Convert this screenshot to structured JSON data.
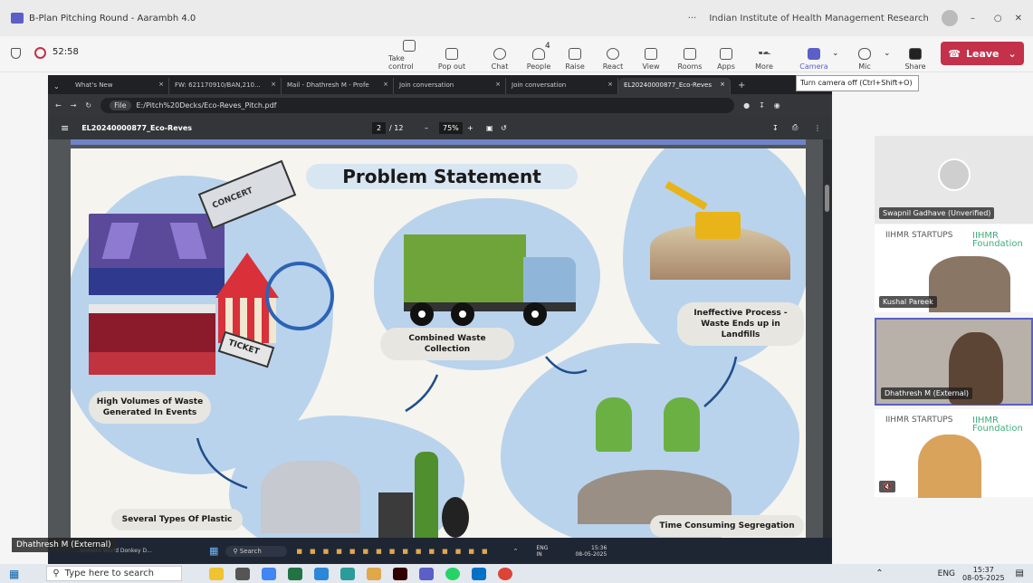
{
  "window": {
    "title": "B-Plan Pitching Round - Aarambh 4.0",
    "org": "Indian Institute of Health Management Research",
    "more": "···"
  },
  "meeting": {
    "timer": "52:58",
    "toolbar": [
      {
        "label": "Take control",
        "icon": "take-control-icon"
      },
      {
        "label": "Pop out",
        "icon": "pop-out-icon"
      },
      {
        "label": "Chat",
        "icon": "chat-icon"
      },
      {
        "label": "People",
        "icon": "people-icon",
        "badge": "4"
      },
      {
        "label": "Raise",
        "icon": "raise-hand-icon"
      },
      {
        "label": "React",
        "icon": "react-icon"
      },
      {
        "label": "View",
        "icon": "view-icon"
      },
      {
        "label": "Rooms",
        "icon": "rooms-icon"
      },
      {
        "label": "Apps",
        "icon": "apps-icon"
      },
      {
        "label": "More",
        "icon": "more-icon"
      },
      {
        "label": "Camera",
        "icon": "camera-icon"
      },
      {
        "label": "Mic",
        "icon": "mic-off-icon"
      },
      {
        "label": "Share",
        "icon": "share-icon"
      }
    ],
    "leave_label": "Leave",
    "tooltip": "Turn camera off (Ctrl+Shift+O)",
    "accent": "#5b5fc7",
    "leave_color": "#c4314b"
  },
  "browser": {
    "tabs": [
      {
        "label": "What's New",
        "close": "×"
      },
      {
        "label": "FW: 621170910/BAN,210...",
        "close": "×"
      },
      {
        "label": "Mail - Dhathresh M - Profe",
        "close": "×"
      },
      {
        "label": "Join conversation",
        "close": "×"
      },
      {
        "label": "Join conversation",
        "close": "×"
      },
      {
        "label": "EL20240000877_Eco-Reves",
        "close": "×"
      }
    ],
    "new_tab": "+",
    "file_chip": "File",
    "url": "E:/Pitch%20Decks/Eco-Reves_Pitch.pdf"
  },
  "pdf": {
    "filename": "EL20240000877_Eco-Reves",
    "page_current": "2",
    "page_total": "/ 12",
    "zoom": "75%",
    "zoom_minus": "–",
    "zoom_plus": "+"
  },
  "slide": {
    "title": "Problem Statement",
    "labels": {
      "events": "High Volumes of Waste Generated In Events",
      "combined": "Combined Waste Collection",
      "ineffective": "Ineffective Process - Waste Ends up in Landfills",
      "plastic": "Several Types Of Plastic",
      "segregation": "Time Consuming Segregation"
    },
    "ticket1": "CONCERT",
    "ticket2": "TICKET"
  },
  "participants": [
    {
      "name": "Swapnil Gadhave (Unverified)",
      "type": "avatar"
    },
    {
      "name": "Kushal Pareek",
      "type": "video"
    },
    {
      "name": "Dhathresh M (External)",
      "type": "video",
      "speaking": true
    },
    {
      "name": "",
      "type": "video"
    }
  ],
  "logos": {
    "a": "IIHMR STARTUPS",
    "b": "IIHMR Foundation"
  },
  "self_label": "Dhathresh M (External)",
  "remote_taskbar": {
    "search": "Search",
    "sys_lang": "ENG",
    "sys_region": "IN",
    "time": "15:36",
    "date": "08-05-2025",
    "notif": "...onment World Donkey D..."
  },
  "taskbar": {
    "search_placeholder": "Type here to search",
    "lang": "ENG",
    "time": "15:37",
    "date": "08-05-2025"
  }
}
